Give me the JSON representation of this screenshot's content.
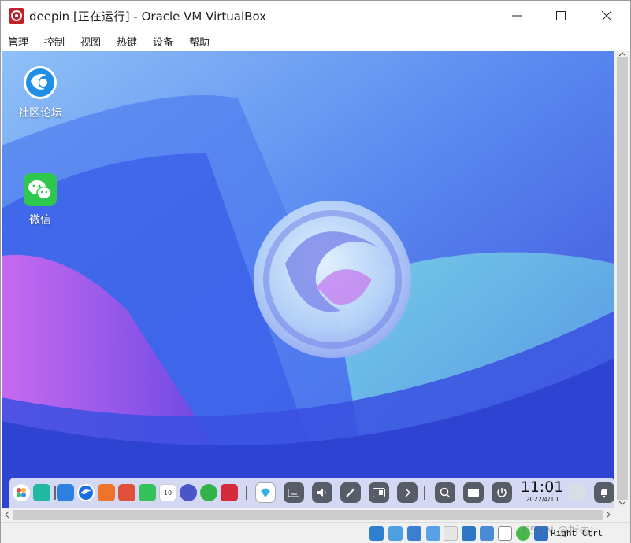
{
  "window": {
    "title": "deepin [正在运行] - Oracle VM VirtualBox"
  },
  "menu": {
    "items": [
      "管理",
      "控制",
      "视图",
      "热键",
      "设备",
      "帮助"
    ]
  },
  "desktop": {
    "icons": [
      {
        "label": "社区论坛",
        "icon": "deepin-forum-icon"
      },
      {
        "label": "微信",
        "icon": "wechat-icon"
      }
    ]
  },
  "taskbar": {
    "time": "11:01",
    "date": "2022/4/10",
    "calendar_day": "10",
    "apps": [
      "launcher",
      "multitasking",
      "file-manager",
      "browser",
      "app-store",
      "image-viewer",
      "music",
      "calendar",
      "settings",
      "downloader",
      "terminal"
    ],
    "tray": [
      "deepin-id",
      "onscreen-keyboard",
      "volume",
      "brush",
      "display",
      "expand",
      "search",
      "keyboard",
      "power",
      "trash",
      "notifications"
    ]
  },
  "statusbar": {
    "host_key": "Right Ctrl",
    "watermark": "CSDN @折枣J"
  },
  "colors": {
    "accent": "#2b6bd6",
    "wallpaper_top": "#5b9bf2",
    "wallpaper_bottom": "#2a3fd0"
  }
}
